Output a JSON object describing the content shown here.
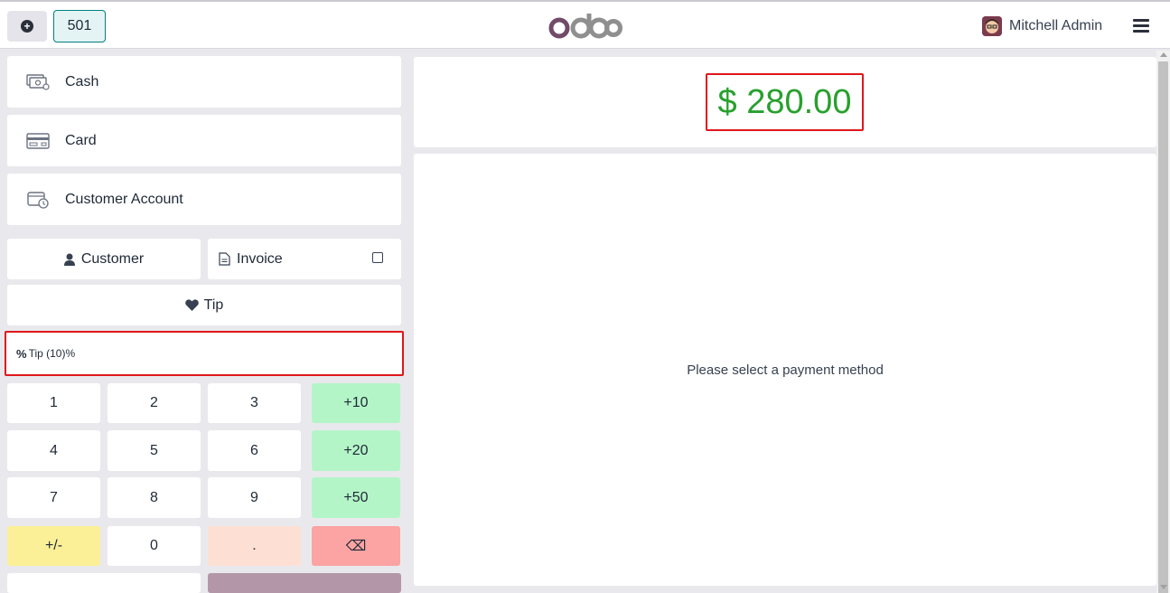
{
  "header": {
    "order_tab": "501",
    "user_name": "Mitchell Admin"
  },
  "payment_methods": [
    {
      "label": "Cash",
      "icon": "cash-icon"
    },
    {
      "label": "Card",
      "icon": "card-icon"
    },
    {
      "label": "Customer Account",
      "icon": "customer-account-icon"
    }
  ],
  "actions": {
    "customer": "Customer",
    "invoice": "Invoice",
    "tip": "Tip"
  },
  "tip_line": {
    "symbol": "%",
    "text": "Tip (10)%"
  },
  "numpad": {
    "k1": "1",
    "k2": "2",
    "k3": "3",
    "k_plus10": "+10",
    "k4": "4",
    "k5": "5",
    "k6": "6",
    "k_plus20": "+20",
    "k7": "7",
    "k8": "8",
    "k9": "9",
    "k_plus50": "+50",
    "k_sign": "+/-",
    "k0": "0",
    "k_dot": ".",
    "k_back": "⌫"
  },
  "summary": {
    "total": "$ 280.00",
    "placeholder": "Please select a payment method"
  },
  "colors": {
    "accent_teal": "#017e84",
    "total_green": "#28a02e",
    "highlight_red": "#e0171b",
    "brand_purple": "#714b67"
  }
}
